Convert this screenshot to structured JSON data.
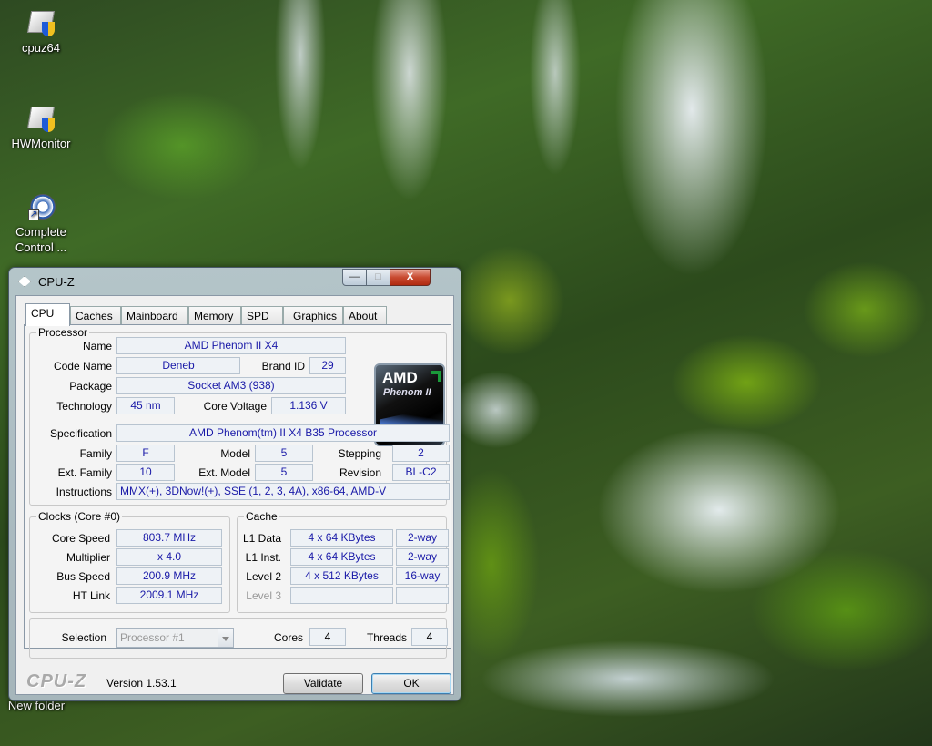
{
  "desktop": {
    "icons": [
      {
        "label": "cpuz64",
        "icon": "cpuz-shield-icon"
      },
      {
        "label": "HWMonitor",
        "icon": "hwmonitor-shield-icon"
      },
      {
        "label": "Complete Control ...",
        "icon": "shortcut-icon"
      },
      {
        "label": "New folder",
        "icon": "folder-icon"
      }
    ]
  },
  "window": {
    "title": "CPU-Z",
    "controls": {
      "minimize": "—",
      "maximize": "□",
      "close": "X"
    },
    "tabs": [
      "CPU",
      "Caches",
      "Mainboard",
      "Memory",
      "SPD",
      "Graphics",
      "About"
    ],
    "active_tab": "CPU",
    "processor": {
      "group_title": "Processor",
      "name_label": "Name",
      "name": "AMD Phenom II X4",
      "codename_label": "Code Name",
      "codename": "Deneb",
      "brandid_label": "Brand ID",
      "brandid": "29",
      "package_label": "Package",
      "package": "Socket AM3 (938)",
      "technology_label": "Technology",
      "technology": "45 nm",
      "voltage_label": "Core Voltage",
      "voltage": "1.136 V",
      "spec_label": "Specification",
      "spec": "AMD Phenom(tm) II X4 B35 Processor",
      "family_label": "Family",
      "family": "F",
      "model_label": "Model",
      "model": "5",
      "stepping_label": "Stepping",
      "stepping": "2",
      "extfamily_label": "Ext. Family",
      "extfamily": "10",
      "extmodel_label": "Ext. Model",
      "extmodel": "5",
      "revision_label": "Revision",
      "revision": "BL-C2",
      "instructions_label": "Instructions",
      "instructions": "MMX(+), 3DNow!(+), SSE (1, 2, 3, 4A), x86-64, AMD-V",
      "logo": {
        "brand": "AMD",
        "product": "Phenom II"
      }
    },
    "clocks": {
      "group_title": "Clocks (Core #0)",
      "corespeed_label": "Core Speed",
      "corespeed": "803.7 MHz",
      "multiplier_label": "Multiplier",
      "multiplier": "x 4.0",
      "busspeed_label": "Bus Speed",
      "busspeed": "200.9 MHz",
      "htlink_label": "HT Link",
      "htlink": "2009.1 MHz"
    },
    "cache": {
      "group_title": "Cache",
      "l1data_label": "L1 Data",
      "l1data": "4 x 64 KBytes",
      "l1data_way": "2-way",
      "l1inst_label": "L1 Inst.",
      "l1inst": "4 x 64 KBytes",
      "l1inst_way": "2-way",
      "l2_label": "Level 2",
      "l2": "4 x 512 KBytes",
      "l2_way": "16-way",
      "l3_label": "Level 3",
      "l3": "",
      "l3_way": ""
    },
    "selection": {
      "label": "Selection",
      "value": "Processor #1",
      "cores_label": "Cores",
      "cores": "4",
      "threads_label": "Threads",
      "threads": "4"
    },
    "footer": {
      "brand": "CPU-Z",
      "version": "Version 1.53.1",
      "validate": "Validate",
      "ok": "OK"
    }
  }
}
